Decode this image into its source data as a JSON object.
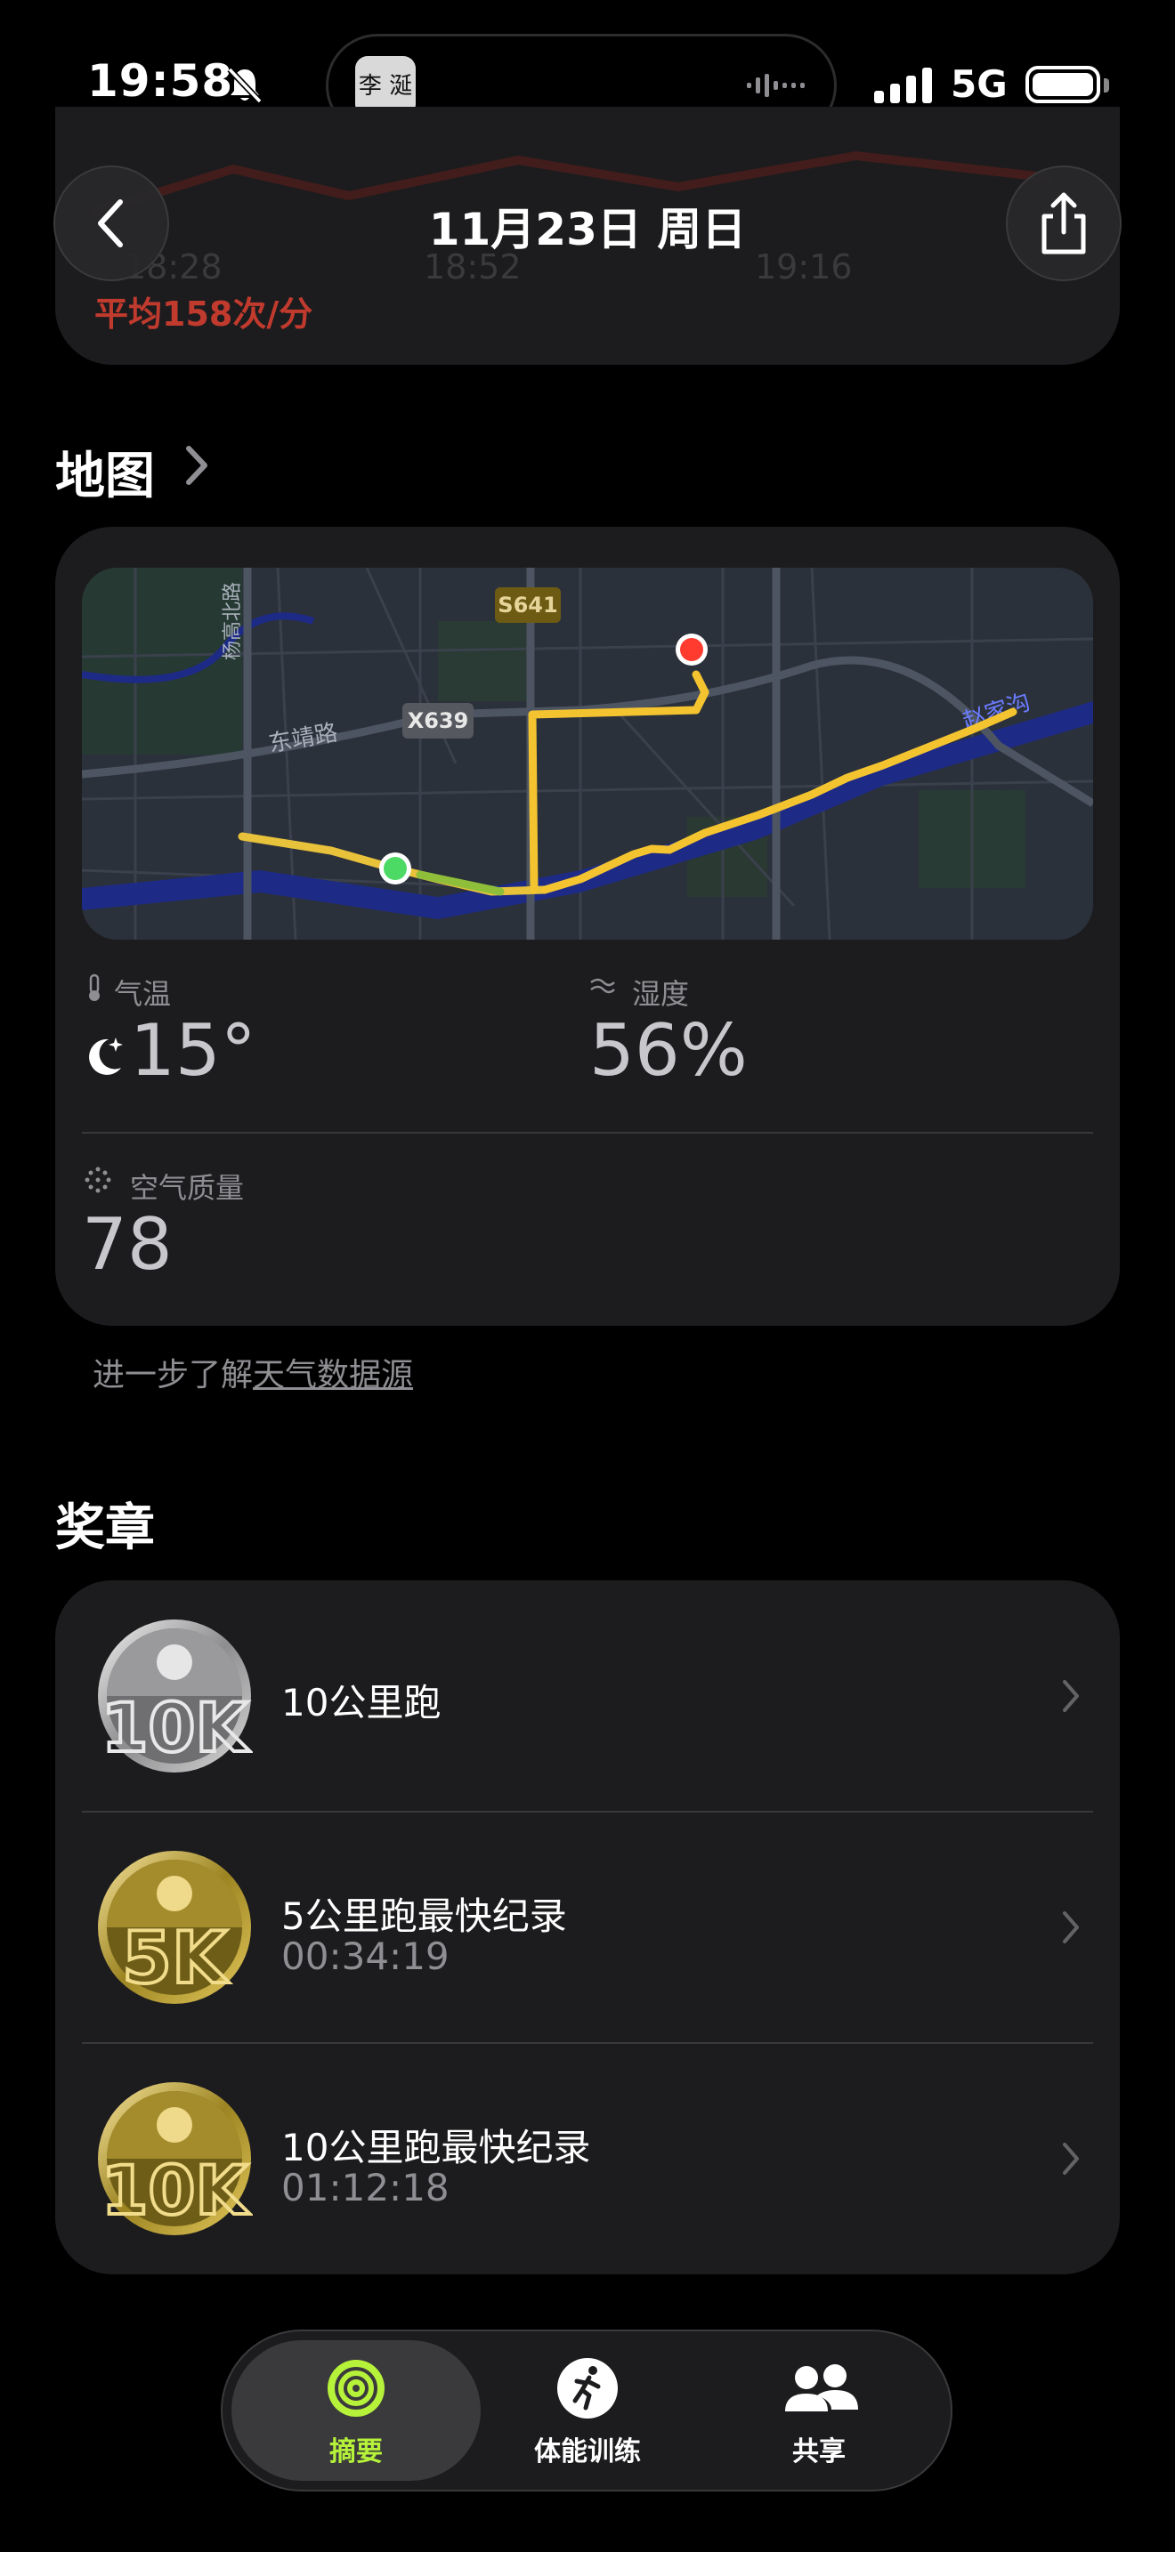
{
  "status_bar": {
    "time": "19:58",
    "network": "5G",
    "island_app_text": "李 涎"
  },
  "header": {
    "ghost_times": [
      "18:28",
      "18:52",
      "19:16"
    ],
    "avg_heart_rate": "平均158次/分",
    "date": "11月23日 周日"
  },
  "map_section": {
    "title": "地图",
    "labels": {
      "road1": "S641",
      "road2": "X639",
      "street1": "东靖路",
      "street2": "赵家沟",
      "street3": "杨高北路",
      "river": "赵家沟"
    }
  },
  "weather": {
    "temperature_label": "气温",
    "temperature_value": "15°",
    "humidity_label": "湿度",
    "humidity_value": "56%",
    "air_quality_label": "空气质量",
    "air_quality_value": "78",
    "learn_more_prefix": "进一步了解",
    "learn_more_link": "天气数据源"
  },
  "awards": {
    "title": "奖章",
    "items": [
      {
        "title": "10公里跑",
        "subtitle": "",
        "medal": "silver-10k",
        "medal_text": "10K"
      },
      {
        "title": "5公里跑最快纪录",
        "subtitle": "00:34:19",
        "medal": "gold-5k",
        "medal_text": "5K"
      },
      {
        "title": "10公里跑最快纪录",
        "subtitle": "01:12:18",
        "medal": "gold-10k",
        "medal_text": "10K"
      }
    ]
  },
  "tabs": [
    {
      "label": "摘要",
      "icon": "activity-rings-icon",
      "active": true,
      "color": "#b6f23a"
    },
    {
      "label": "体能训练",
      "icon": "running-figure-icon",
      "active": false,
      "color": "#ffffff"
    },
    {
      "label": "共享",
      "icon": "people-icon",
      "active": false,
      "color": "#ffffff"
    }
  ],
  "colors": {
    "route": "#f4c430",
    "start_dot": "#4cd964",
    "end_dot": "#ff3b30",
    "accent_green": "#b6f23a",
    "heart_rate_red": "#c13a2e"
  }
}
